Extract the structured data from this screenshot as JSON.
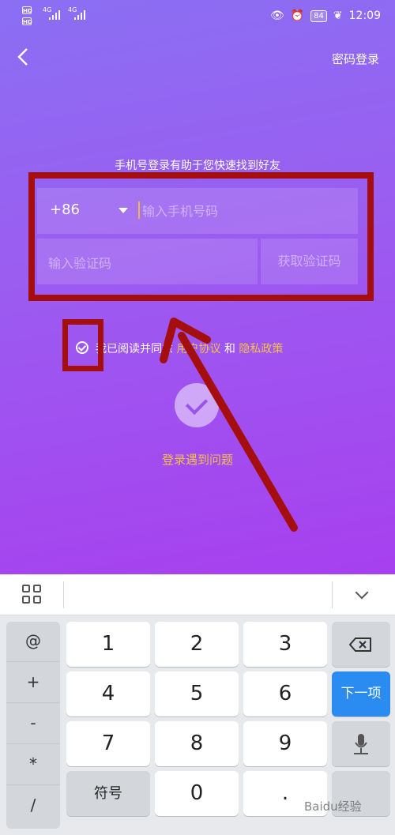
{
  "status": {
    "hd1": "HD",
    "hd2": "HD",
    "net1": "4G",
    "net2": "4G",
    "battery": "84",
    "time": "12:09"
  },
  "header": {
    "password_login": "密码登录"
  },
  "hint": "手机号登录有助于您快速找到好友",
  "phone": {
    "country_code": "+86",
    "placeholder": "输入手机号码"
  },
  "code": {
    "placeholder": "输入验证码",
    "get_code": "获取验证码"
  },
  "agree": {
    "prefix": "我已阅读并同意",
    "user_agreement": "用户协议",
    "and": "和",
    "privacy": "隐私政策"
  },
  "problem": "登录遇到问题",
  "keyboard": {
    "symbols": [
      "@",
      "+",
      "-",
      "*",
      "/"
    ],
    "row1": [
      "1",
      "2",
      "3"
    ],
    "row2": [
      "4",
      "5",
      "6"
    ],
    "row3": [
      "7",
      "8",
      "9"
    ],
    "row4": [
      "符号",
      "0",
      "."
    ],
    "next": "下一项"
  },
  "watermark": "Baidu经验",
  "colors": {
    "accent": "#f3c04a",
    "annotation_red": "#a40e0e",
    "next_blue": "#2a8bf1"
  }
}
